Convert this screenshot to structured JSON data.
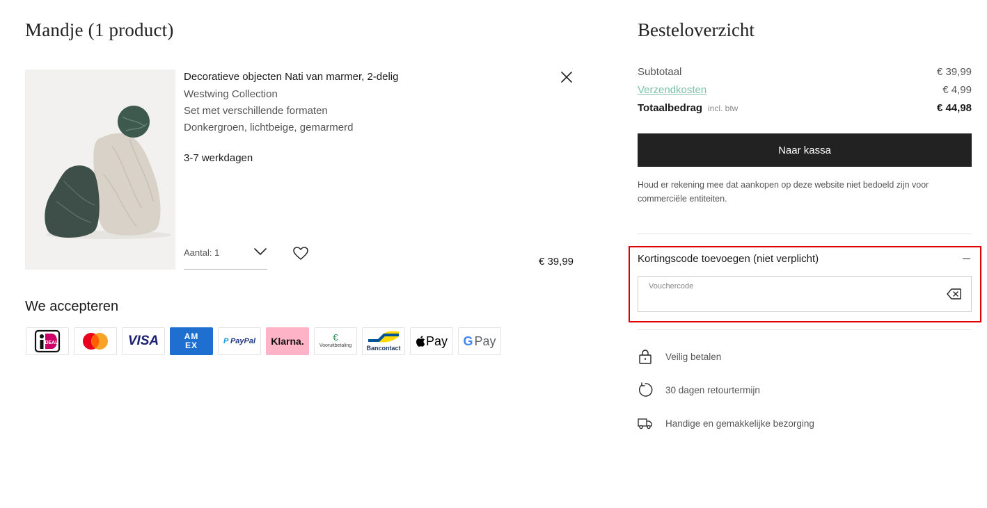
{
  "cart": {
    "title": "Mandje (1 product)",
    "item": {
      "name": "Decoratieve objecten Nati van marmer, 2-delig",
      "brand": "Westwing Collection",
      "variant": "Set met verschillende formaten",
      "color": "Donkergroen, lichtbeige, gemarmerd",
      "delivery": "3-7 werkdagen",
      "quantity_label": "Aantal: 1",
      "price": "€ 39,99",
      "remove_icon": "close-icon",
      "wishlist_icon": "heart-icon"
    },
    "accept_title": "We accepteren",
    "payment_methods": [
      {
        "name": "iDEAL",
        "label": "iDEAL"
      },
      {
        "name": "Mastercard",
        "label": ""
      },
      {
        "name": "Visa",
        "label": "VISA"
      },
      {
        "name": "American Express",
        "label": "AM EX"
      },
      {
        "name": "PayPal",
        "label": "PayPal"
      },
      {
        "name": "Klarna",
        "label": "Klarna."
      },
      {
        "name": "Vooruitbetaling",
        "label": "Vooruitbetaling",
        "symbol": "€"
      },
      {
        "name": "Bancontact",
        "label": "Bancontact"
      },
      {
        "name": "Apple Pay",
        "label": "Pay"
      },
      {
        "name": "Google Pay",
        "label": "Pay",
        "g": "G"
      }
    ]
  },
  "summary": {
    "title": "Besteloverzicht",
    "subtotal_label": "Subtotaal",
    "subtotal_value": "€ 39,99",
    "shipping_label": "Verzendkosten",
    "shipping_value": "€ 4,99",
    "total_label": "Totaalbedrag",
    "total_note": "incl. btw",
    "total_value": "€ 44,98",
    "checkout_label": "Naar kassa",
    "notice": "Houd er rekening mee dat aankopen op deze website niet bedoeld zijn voor commerciële entiteiten."
  },
  "voucher": {
    "title": "Kortingscode toevoegen (niet verplicht)",
    "field_label": "Vouchercode",
    "value": "",
    "clear_icon": "backspace-clear-icon"
  },
  "usps": [
    {
      "icon": "lock-icon",
      "text": "Veilig betalen"
    },
    {
      "icon": "return-arrow-icon",
      "text": "30 dagen retourtermijn"
    },
    {
      "icon": "delivery-truck-icon",
      "text": "Handige en gemakkelijke bezorging"
    }
  ],
  "colors": {
    "accent_link": "#7cc0a6",
    "button_dark": "#222222",
    "highlight_border": "#e00000"
  }
}
